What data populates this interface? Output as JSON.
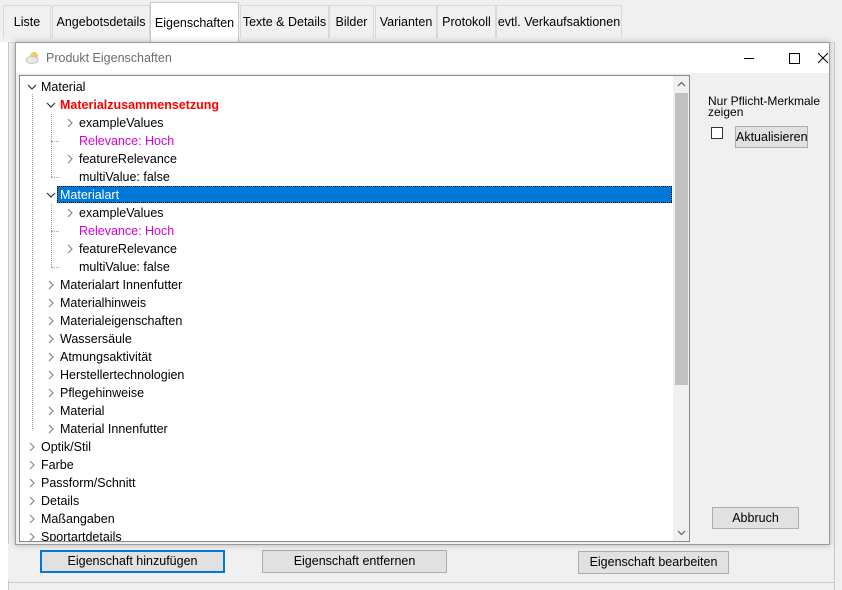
{
  "tabs": [
    "Liste",
    "Angebotsdetails",
    "Eigenschaften",
    "Texte & Details",
    "Bilder",
    "Varianten",
    "Protokoll",
    "evtl. Verkaufsaktionen"
  ],
  "background_buttons": {
    "add": "Eigenschaft hinzufügen",
    "remove": "Eigenschaft entfernen",
    "edit": "Eigenschaft bearbeiten"
  },
  "dialog": {
    "title": "Produkt Eigenschaften",
    "side": {
      "checkbox_label": "Nur Pflicht-Merkmale zeigen",
      "checkbox_checked": false,
      "refresh": "Aktualisieren",
      "cancel": "Abbruch"
    },
    "tree": [
      {
        "label": "Material",
        "level": 0,
        "toggle": "expanded",
        "style": "normal"
      },
      {
        "label": "Materialzusammensetzung",
        "level": 1,
        "toggle": "expanded",
        "style": "required"
      },
      {
        "label": "exampleValues",
        "level": 2,
        "toggle": "collapsed",
        "style": "normal"
      },
      {
        "label": "Relevance: Hoch",
        "level": 2,
        "toggle": "none",
        "style": "relevance"
      },
      {
        "label": "featureRelevance",
        "level": 2,
        "toggle": "collapsed",
        "style": "normal"
      },
      {
        "label": "multiValue: false",
        "level": 2,
        "toggle": "none",
        "style": "normal"
      },
      {
        "label": "Materialart",
        "level": 1,
        "toggle": "expanded",
        "style": "selected"
      },
      {
        "label": "exampleValues",
        "level": 2,
        "toggle": "collapsed",
        "style": "normal"
      },
      {
        "label": "Relevance: Hoch",
        "level": 2,
        "toggle": "none",
        "style": "relevance"
      },
      {
        "label": "featureRelevance",
        "level": 2,
        "toggle": "collapsed",
        "style": "normal"
      },
      {
        "label": "multiValue: false",
        "level": 2,
        "toggle": "none",
        "style": "normal"
      },
      {
        "label": "Materialart Innenfutter",
        "level": 1,
        "toggle": "collapsed",
        "style": "normal"
      },
      {
        "label": "Materialhinweis",
        "level": 1,
        "toggle": "collapsed",
        "style": "normal"
      },
      {
        "label": "Materialeigenschaften",
        "level": 1,
        "toggle": "collapsed",
        "style": "normal"
      },
      {
        "label": "Wassersäule",
        "level": 1,
        "toggle": "collapsed",
        "style": "normal"
      },
      {
        "label": "Atmungsaktivität",
        "level": 1,
        "toggle": "collapsed",
        "style": "normal"
      },
      {
        "label": "Herstellertechnologien",
        "level": 1,
        "toggle": "collapsed",
        "style": "normal"
      },
      {
        "label": "Pflegehinweise",
        "level": 1,
        "toggle": "collapsed",
        "style": "normal"
      },
      {
        "label": "Material",
        "level": 1,
        "toggle": "collapsed",
        "style": "normal"
      },
      {
        "label": "Material Innenfutter",
        "level": 1,
        "toggle": "collapsed",
        "style": "normal"
      },
      {
        "label": "Optik/Stil",
        "level": 0,
        "toggle": "collapsed",
        "style": "normal"
      },
      {
        "label": "Farbe",
        "level": 0,
        "toggle": "collapsed",
        "style": "normal"
      },
      {
        "label": "Passform/Schnitt",
        "level": 0,
        "toggle": "collapsed",
        "style": "normal"
      },
      {
        "label": "Details",
        "level": 0,
        "toggle": "collapsed",
        "style": "normal"
      },
      {
        "label": "Maßangaben",
        "level": 0,
        "toggle": "collapsed",
        "style": "normal"
      },
      {
        "label": "Sportartdetails",
        "level": 0,
        "toggle": "collapsed",
        "style": "normal"
      }
    ],
    "colors": {
      "required": "#ff0000",
      "relevance": "#d400d4",
      "selection": "#0078d7"
    }
  }
}
